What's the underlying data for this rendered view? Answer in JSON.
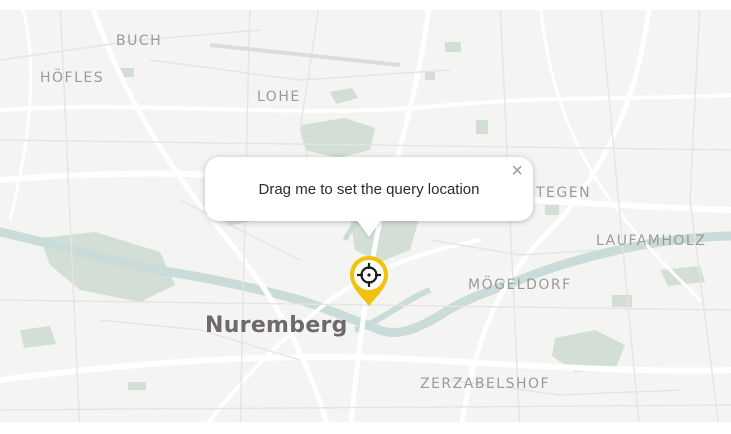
{
  "map": {
    "places": [
      {
        "id": "buch",
        "label": "BUCH"
      },
      {
        "id": "hofles",
        "label": "HÖFLES"
      },
      {
        "id": "lohe",
        "label": "LOHE"
      },
      {
        "id": "tegen",
        "label": "TEGEN"
      },
      {
        "id": "laufamholz",
        "label": "LAUFAMHOLZ"
      },
      {
        "id": "mogeldorf",
        "label": "MÖGELDORF"
      },
      {
        "id": "zerzabelshof",
        "label": "ZERZABELSHOF"
      }
    ],
    "city": "Nuremberg"
  },
  "popup": {
    "text": "Drag me to set the query location",
    "close_symbol": "×"
  },
  "marker": {
    "icon": "crosshair-icon",
    "color": "#f2c20a"
  },
  "colors": {
    "land": "#f4f4f3",
    "road": "#ffffff",
    "water": "#cfe0de",
    "park": "#d6e1da"
  }
}
